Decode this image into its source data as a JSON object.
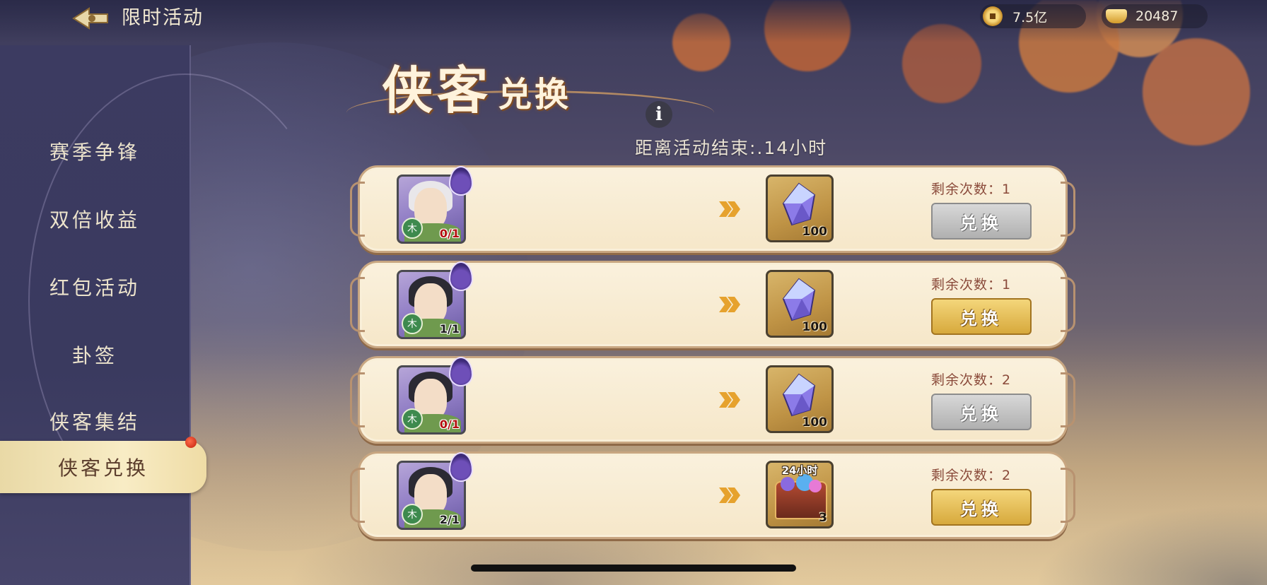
{
  "header": {
    "title": "限时活动",
    "back_icon": "back-arrow-icon",
    "currencies": [
      {
        "name": "coin",
        "icon": "coin-icon",
        "value": "7.5亿"
      },
      {
        "name": "ingot",
        "icon": "gold-ingot-icon",
        "value": "20487"
      }
    ]
  },
  "sidebar": {
    "items": [
      {
        "label": "赛季争锋",
        "active": false
      },
      {
        "label": "双倍收益",
        "active": false
      },
      {
        "label": "红包活动",
        "active": false
      },
      {
        "label": "卦签",
        "active": false
      },
      {
        "label": "侠客集结",
        "active": false
      },
      {
        "label": "侠客兑换",
        "active": true,
        "has_notification": true
      }
    ]
  },
  "event": {
    "title_big": "侠客",
    "title_small": "兑换",
    "countdown": "距离活动结束:.14小时"
  },
  "rows": [
    {
      "hero_element": "木",
      "hero_count": "0/1",
      "hero_sufficient": false,
      "reward_icon": "crystal-icon",
      "reward_qty": "100",
      "reward_time": "",
      "remaining": "剩余次数：1",
      "button_label": "兑换",
      "button_enabled": false
    },
    {
      "hero_element": "木",
      "hero_count": "1/1",
      "hero_sufficient": true,
      "reward_icon": "crystal-icon",
      "reward_qty": "100",
      "reward_time": "",
      "remaining": "剩余次数：1",
      "button_label": "兑换",
      "button_enabled": true
    },
    {
      "hero_element": "木",
      "hero_count": "0/1",
      "hero_sufficient": false,
      "reward_icon": "crystal-icon",
      "reward_qty": "100",
      "reward_time": "",
      "remaining": "剩余次数：2",
      "button_label": "兑换",
      "button_enabled": false
    },
    {
      "hero_element": "木",
      "hero_count": "2/1",
      "hero_sufficient": true,
      "reward_icon": "treasure-chest-icon",
      "reward_qty": "3",
      "reward_time": "24小时",
      "remaining": "剩余次数：2",
      "button_label": "兑换",
      "button_enabled": true
    }
  ],
  "colors": {
    "sidebar_bg": "#3c3b61",
    "row_bg": "#faf1dd",
    "button_enabled": "#e2b850",
    "button_disabled": "#c0c0c0",
    "count_insufficient": "#b30f0f"
  }
}
